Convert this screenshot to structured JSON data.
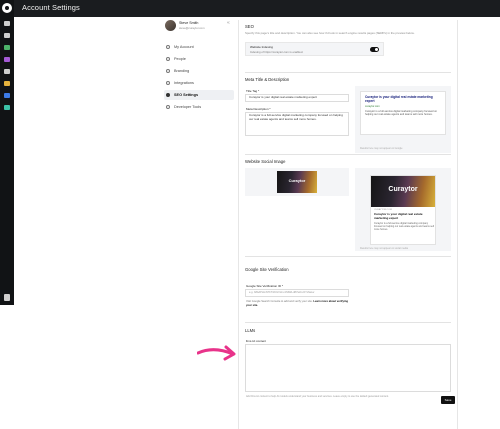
{
  "app": {
    "title": "Account Settings",
    "accent_color": "#e8338a",
    "rail_icons": [
      {
        "name": "dashboard-icon",
        "color": "#cfcfcf"
      },
      {
        "name": "pages-icon",
        "color": "#cfcfcf"
      },
      {
        "name": "stats-icon",
        "color": "#4db36a"
      },
      {
        "name": "grid-icon",
        "color": "#a55ad6"
      },
      {
        "name": "calendar-icon",
        "color": "#cfcfcf"
      },
      {
        "name": "wifi-icon",
        "color": "#e6b33d"
      },
      {
        "name": "mail-icon",
        "color": "#3d7be6"
      },
      {
        "name": "cursor-icon",
        "color": "#3cc2a8"
      }
    ]
  },
  "profile": {
    "name": "Steve Smith",
    "email": "steve@curaytor.com",
    "collapse_glyph": "«"
  },
  "nav": {
    "items": [
      {
        "label": "My Account",
        "active": false
      },
      {
        "label": "People",
        "active": false
      },
      {
        "label": "Branding",
        "active": false
      },
      {
        "label": "Integrations",
        "active": false
      },
      {
        "label": "SEO Settings",
        "active": true
      },
      {
        "label": "Developer Tools",
        "active": false
      }
    ]
  },
  "seo": {
    "title": "SEO",
    "description": "Specify this page's title and description. You can also see how it'd look in search engine results pages (SERPs) in the preview below.",
    "indexing_label": "Website Indexing",
    "indexing_status": "Indexing of https://curaytor.com is enabled."
  },
  "meta": {
    "title": "Meta Title & Description",
    "title_tag_label": "Title Tag *",
    "title_tag_value": "Curaytor is your digital real estate marketing expert",
    "meta_desc_label": "Meta Description *",
    "meta_desc_value": "Curaytor is a full-service digital marketing company focused on helping our real estate agents and teams sell more homes.",
    "preview_title": "Curaytor is your digital real estate marketing expert",
    "preview_url": "curaytor.com",
    "preview_desc": "Curaytor is a full-service digital marketing company focused on helping our real estate agents and teams sell more homes.",
    "hint": "Results here may not appear on Google"
  },
  "social": {
    "title": "Website Social Image",
    "brand": "Curaytor",
    "card_domain": "CURAYTOR.COM",
    "card_title": "Curaytor is your digital real estate marketing expert",
    "card_desc": "Curaytor is a full-service digital marketing company focused on helping our real estate agents and teams sell more homes.",
    "hint": "Results here may not appear on social media"
  },
  "google": {
    "title": "Google Site Verification",
    "field_label": "Google Site Verification ID *",
    "field_value": "e.g. b8AdPHmN7bT1K0cVHr-nzM9fA-d8VwD-2JYx6aLw",
    "help_text": "Visit Google Search Console to add and verify your site.",
    "help_link": "Learn more about verifying your site."
  },
  "llms": {
    "title": "LLMs",
    "field_label": "llms.txt content",
    "field_value": "",
    "help_text": "Add llms.txt content to help AI models understand your business and services. Leave empty to use the default generated content."
  },
  "actions": {
    "save_label": "Save"
  }
}
